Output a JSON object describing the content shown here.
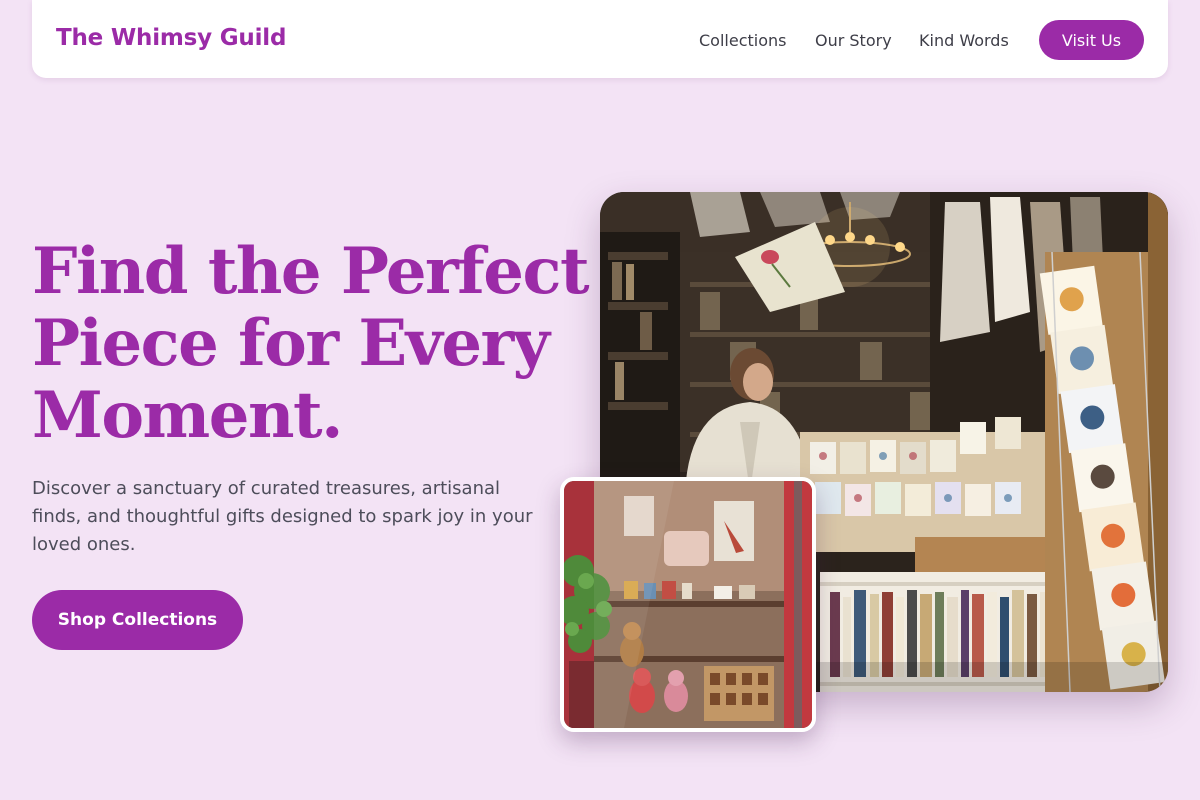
{
  "brand": {
    "name": "The Whimsy Guild"
  },
  "nav": {
    "links": [
      "Collections",
      "Our Story",
      "Kind Words"
    ],
    "cta_label": "Visit Us"
  },
  "hero": {
    "headline_lines": [
      "Find the Perfect",
      "Piece for Every",
      "Moment."
    ],
    "description": "Discover a sanctuary of curated treasures, artisanal finds, and thoughtful gifts designed to spark joy in your loved ones.",
    "button_label": "Shop Collections"
  },
  "colors": {
    "accent": "#9b2ba7",
    "background": "#f3e3f5",
    "body_text": "#4d4d5a",
    "nav_text": "#3e3e48"
  }
}
